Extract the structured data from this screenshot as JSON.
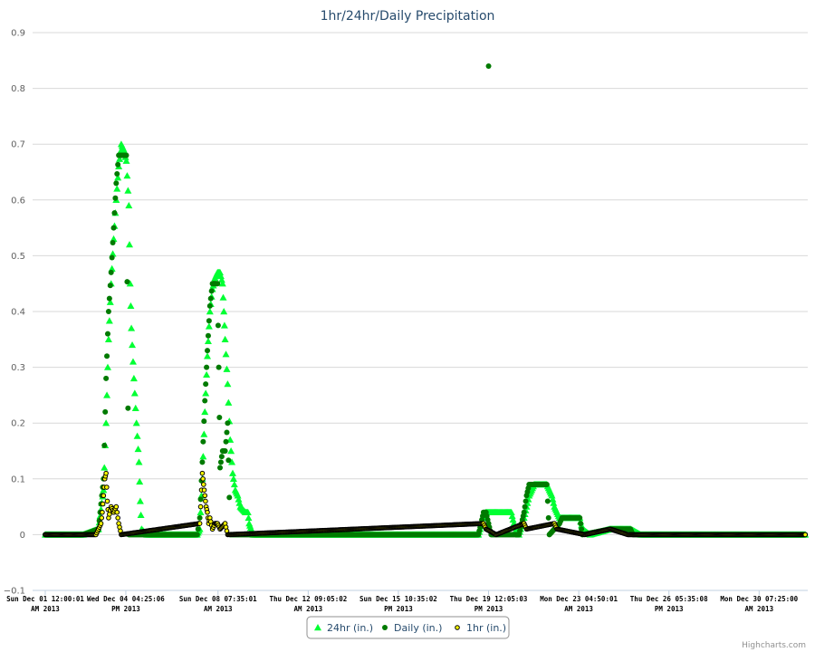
{
  "chart_data": {
    "type": "scatter",
    "title": "1hr/24hr/Daily Precipitation",
    "xlabel": "",
    "ylabel": "",
    "ylim": [
      -0.1,
      0.9
    ],
    "yticks": [
      -0.1,
      0,
      0.1,
      0.2,
      0.3,
      0.4,
      0.5,
      0.6,
      0.7,
      0.8,
      0.9
    ],
    "ytick_labels": [
      "−0.1",
      "0",
      "0.1",
      "0.2",
      "0.3",
      "0.4",
      "0.5",
      "0.6",
      "0.7",
      "0.8",
      "0.9"
    ],
    "xlim": [
      0,
      30.6
    ],
    "xticks": [
      {
        "day": 0.5,
        "line1": "Sun Dec 01 12:00:01",
        "line2": "AM 2013"
      },
      {
        "day": 3.68,
        "line1": "Wed Dec 04 04:25:06",
        "line2": "PM 2013"
      },
      {
        "day": 7.32,
        "line1": "Sun Dec 08 07:35:01",
        "line2": "AM 2013"
      },
      {
        "day": 10.88,
        "line1": "Thu Dec 12 09:05:02",
        "line2": "AM 2013"
      },
      {
        "day": 14.44,
        "line1": "Sun Dec 15 10:35:02",
        "line2": "PM 2013"
      },
      {
        "day": 18.0,
        "line1": "Thu Dec 19 12:05:03",
        "line2": "PM 2013"
      },
      {
        "day": 21.56,
        "line1": "Mon Dec 23 04:50:01",
        "line2": "AM 2013"
      },
      {
        "day": 25.12,
        "line1": "Thu Dec 26 05:35:08",
        "line2": "PM 2013"
      },
      {
        "day": 28.68,
        "line1": "Mon Dec 30 07:25:00",
        "line2": "AM 2013"
      }
    ],
    "grid": true,
    "legend_position": "bottom",
    "credits": "Highcharts.com",
    "series": [
      {
        "name": "24hr (in.)",
        "marker": "triangle",
        "color": "#00ff33",
        "points": [
          [
            0.5,
            0
          ],
          [
            2.0,
            0
          ],
          [
            2.6,
            0.01
          ],
          [
            2.8,
            0.08
          ],
          [
            2.9,
            0.2
          ],
          [
            3.0,
            0.35
          ],
          [
            3.1,
            0.45
          ],
          [
            3.2,
            0.53
          ],
          [
            3.3,
            0.6
          ],
          [
            3.4,
            0.66
          ],
          [
            3.5,
            0.7
          ],
          [
            3.6,
            0.69
          ],
          [
            3.7,
            0.67
          ],
          [
            3.8,
            0.59
          ],
          [
            3.85,
            0.45
          ],
          [
            3.9,
            0.37
          ],
          [
            4.0,
            0.28
          ],
          [
            4.1,
            0.2
          ],
          [
            4.2,
            0.13
          ],
          [
            4.25,
            0.06
          ],
          [
            4.3,
            0.01
          ],
          [
            4.5,
            0
          ],
          [
            6.5,
            0
          ],
          [
            6.6,
            0.01
          ],
          [
            6.7,
            0.1
          ],
          [
            6.8,
            0.22
          ],
          [
            6.9,
            0.32
          ],
          [
            7.0,
            0.4
          ],
          [
            7.1,
            0.44
          ],
          [
            7.2,
            0.46
          ],
          [
            7.3,
            0.47
          ],
          [
            7.4,
            0.47
          ],
          [
            7.5,
            0.45
          ],
          [
            7.55,
            0.4
          ],
          [
            7.6,
            0.35
          ],
          [
            7.7,
            0.27
          ],
          [
            7.8,
            0.17
          ],
          [
            7.9,
            0.11
          ],
          [
            8.0,
            0.08
          ],
          [
            8.1,
            0.07
          ],
          [
            8.2,
            0.05
          ],
          [
            8.4,
            0.04
          ],
          [
            8.5,
            0.04
          ],
          [
            8.55,
            0.02
          ],
          [
            8.7,
            0
          ],
          [
            17.6,
            0
          ],
          [
            17.8,
            0.03
          ],
          [
            17.9,
            0.04
          ],
          [
            18.5,
            0.04
          ],
          [
            18.9,
            0.04
          ],
          [
            19.0,
            0.02
          ],
          [
            19.2,
            0
          ],
          [
            19.4,
            0.03
          ],
          [
            19.6,
            0.07
          ],
          [
            19.8,
            0.09
          ],
          [
            20.3,
            0.09
          ],
          [
            20.5,
            0.07
          ],
          [
            20.6,
            0.05
          ],
          [
            20.8,
            0.03
          ],
          [
            21.4,
            0.03
          ],
          [
            21.6,
            0.03
          ],
          [
            21.7,
            0.01
          ],
          [
            22.0,
            0
          ],
          [
            22.8,
            0.01
          ],
          [
            23.4,
            0.01
          ],
          [
            23.6,
            0.01
          ],
          [
            24.0,
            0
          ],
          [
            30.5,
            0
          ]
        ]
      },
      {
        "name": "Daily (in.)",
        "marker": "circle",
        "color": "#007a00",
        "points": [
          [
            0.5,
            0
          ],
          [
            2.0,
            0
          ],
          [
            2.6,
            0.01
          ],
          [
            2.8,
            0.1
          ],
          [
            2.9,
            0.28
          ],
          [
            3.0,
            0.4
          ],
          [
            3.1,
            0.47
          ],
          [
            3.2,
            0.55
          ],
          [
            3.3,
            0.63
          ],
          [
            3.4,
            0.68
          ],
          [
            3.5,
            0.68
          ],
          [
            3.6,
            0.68
          ],
          [
            3.7,
            0.68
          ],
          [
            3.8,
            0
          ],
          [
            6.5,
            0
          ],
          [
            6.6,
            0.03
          ],
          [
            6.7,
            0.13
          ],
          [
            6.8,
            0.24
          ],
          [
            6.9,
            0.33
          ],
          [
            7.0,
            0.41
          ],
          [
            7.1,
            0.45
          ],
          [
            7.2,
            0.45
          ],
          [
            7.3,
            0.45
          ],
          [
            7.35,
            0.3
          ],
          [
            7.4,
            0.12
          ],
          [
            7.5,
            0.15
          ],
          [
            7.6,
            0.15
          ],
          [
            7.7,
            0.2
          ],
          [
            7.8,
            0
          ],
          [
            17.6,
            0
          ],
          [
            17.7,
            0.02
          ],
          [
            17.8,
            0.04
          ],
          [
            17.9,
            0.04
          ],
          [
            18.0,
            0.84
          ],
          [
            18.1,
            0
          ],
          [
            19.2,
            0
          ],
          [
            19.4,
            0.04
          ],
          [
            19.5,
            0.07
          ],
          [
            19.6,
            0.09
          ],
          [
            20.3,
            0.09
          ],
          [
            20.4,
            0
          ],
          [
            20.8,
            0.02
          ],
          [
            20.9,
            0.03
          ],
          [
            21.6,
            0.03
          ],
          [
            21.7,
            0
          ],
          [
            22.8,
            0.01
          ],
          [
            23.6,
            0.01
          ],
          [
            23.7,
            0
          ],
          [
            30.5,
            0
          ]
        ]
      },
      {
        "name": "1hr (in.)",
        "marker": "circle-outline",
        "color": "#ffff00",
        "points": [
          [
            0.5,
            0
          ],
          [
            2.5,
            0
          ],
          [
            2.6,
            0.01
          ],
          [
            2.7,
            0.02
          ],
          [
            2.75,
            0.04
          ],
          [
            2.8,
            0.07
          ],
          [
            2.85,
            0.1
          ],
          [
            2.9,
            0.11
          ],
          [
            2.95,
            0.06
          ],
          [
            3.0,
            0.03
          ],
          [
            3.1,
            0.05
          ],
          [
            3.2,
            0.04
          ],
          [
            3.3,
            0.05
          ],
          [
            3.4,
            0.02
          ],
          [
            3.5,
            0
          ],
          [
            6.6,
            0.02
          ],
          [
            6.7,
            0.11
          ],
          [
            6.75,
            0.09
          ],
          [
            6.8,
            0.07
          ],
          [
            6.85,
            0.05
          ],
          [
            6.9,
            0.04
          ],
          [
            6.95,
            0.02
          ],
          [
            7.0,
            0.03
          ],
          [
            7.1,
            0.01
          ],
          [
            7.2,
            0.02
          ],
          [
            7.3,
            0.02
          ],
          [
            7.4,
            0.01
          ],
          [
            7.6,
            0.02
          ],
          [
            7.7,
            0
          ],
          [
            17.8,
            0.02
          ],
          [
            17.9,
            0.01
          ],
          [
            18.3,
            0
          ],
          [
            19.4,
            0.02
          ],
          [
            19.5,
            0.01
          ],
          [
            20.6,
            0.02
          ],
          [
            20.7,
            0.01
          ],
          [
            21.8,
            0
          ],
          [
            22.8,
            0.01
          ],
          [
            23.5,
            0
          ],
          [
            30.5,
            0
          ]
        ]
      }
    ]
  }
}
